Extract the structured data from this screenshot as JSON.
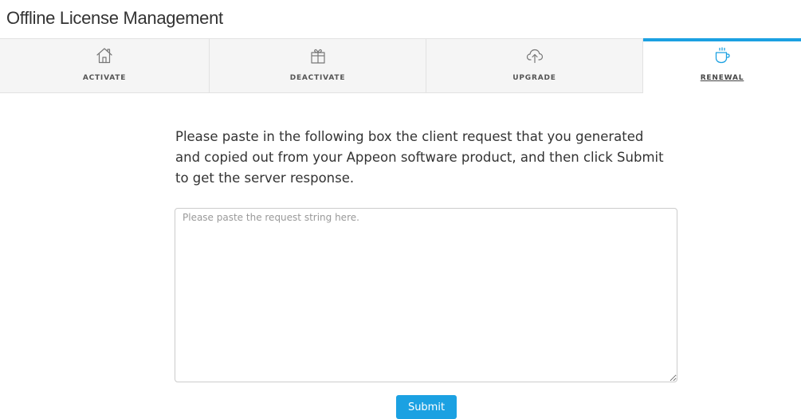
{
  "header": {
    "title": "Offline License Management"
  },
  "tabs": [
    {
      "label": "ACTIVATE",
      "icon": "home-icon",
      "active": false
    },
    {
      "label": "DEACTIVATE",
      "icon": "gift-icon",
      "active": false
    },
    {
      "label": "UPGRADE",
      "icon": "cloud-upload-icon",
      "active": false
    },
    {
      "label": "RENEWAL",
      "icon": "coffee-cup-icon",
      "active": true
    }
  ],
  "main": {
    "instructions": "Please paste in the following box the client request that you generated and copied out from your Appeon software product, and then click Submit to get the server response.",
    "request_box": {
      "value": "",
      "placeholder": "Please paste the request string here."
    },
    "submit_label": "Submit"
  },
  "colors": {
    "accent": "#1ba1e2",
    "tab_background": "#f5f5f5",
    "border": "#e2e2e2"
  }
}
